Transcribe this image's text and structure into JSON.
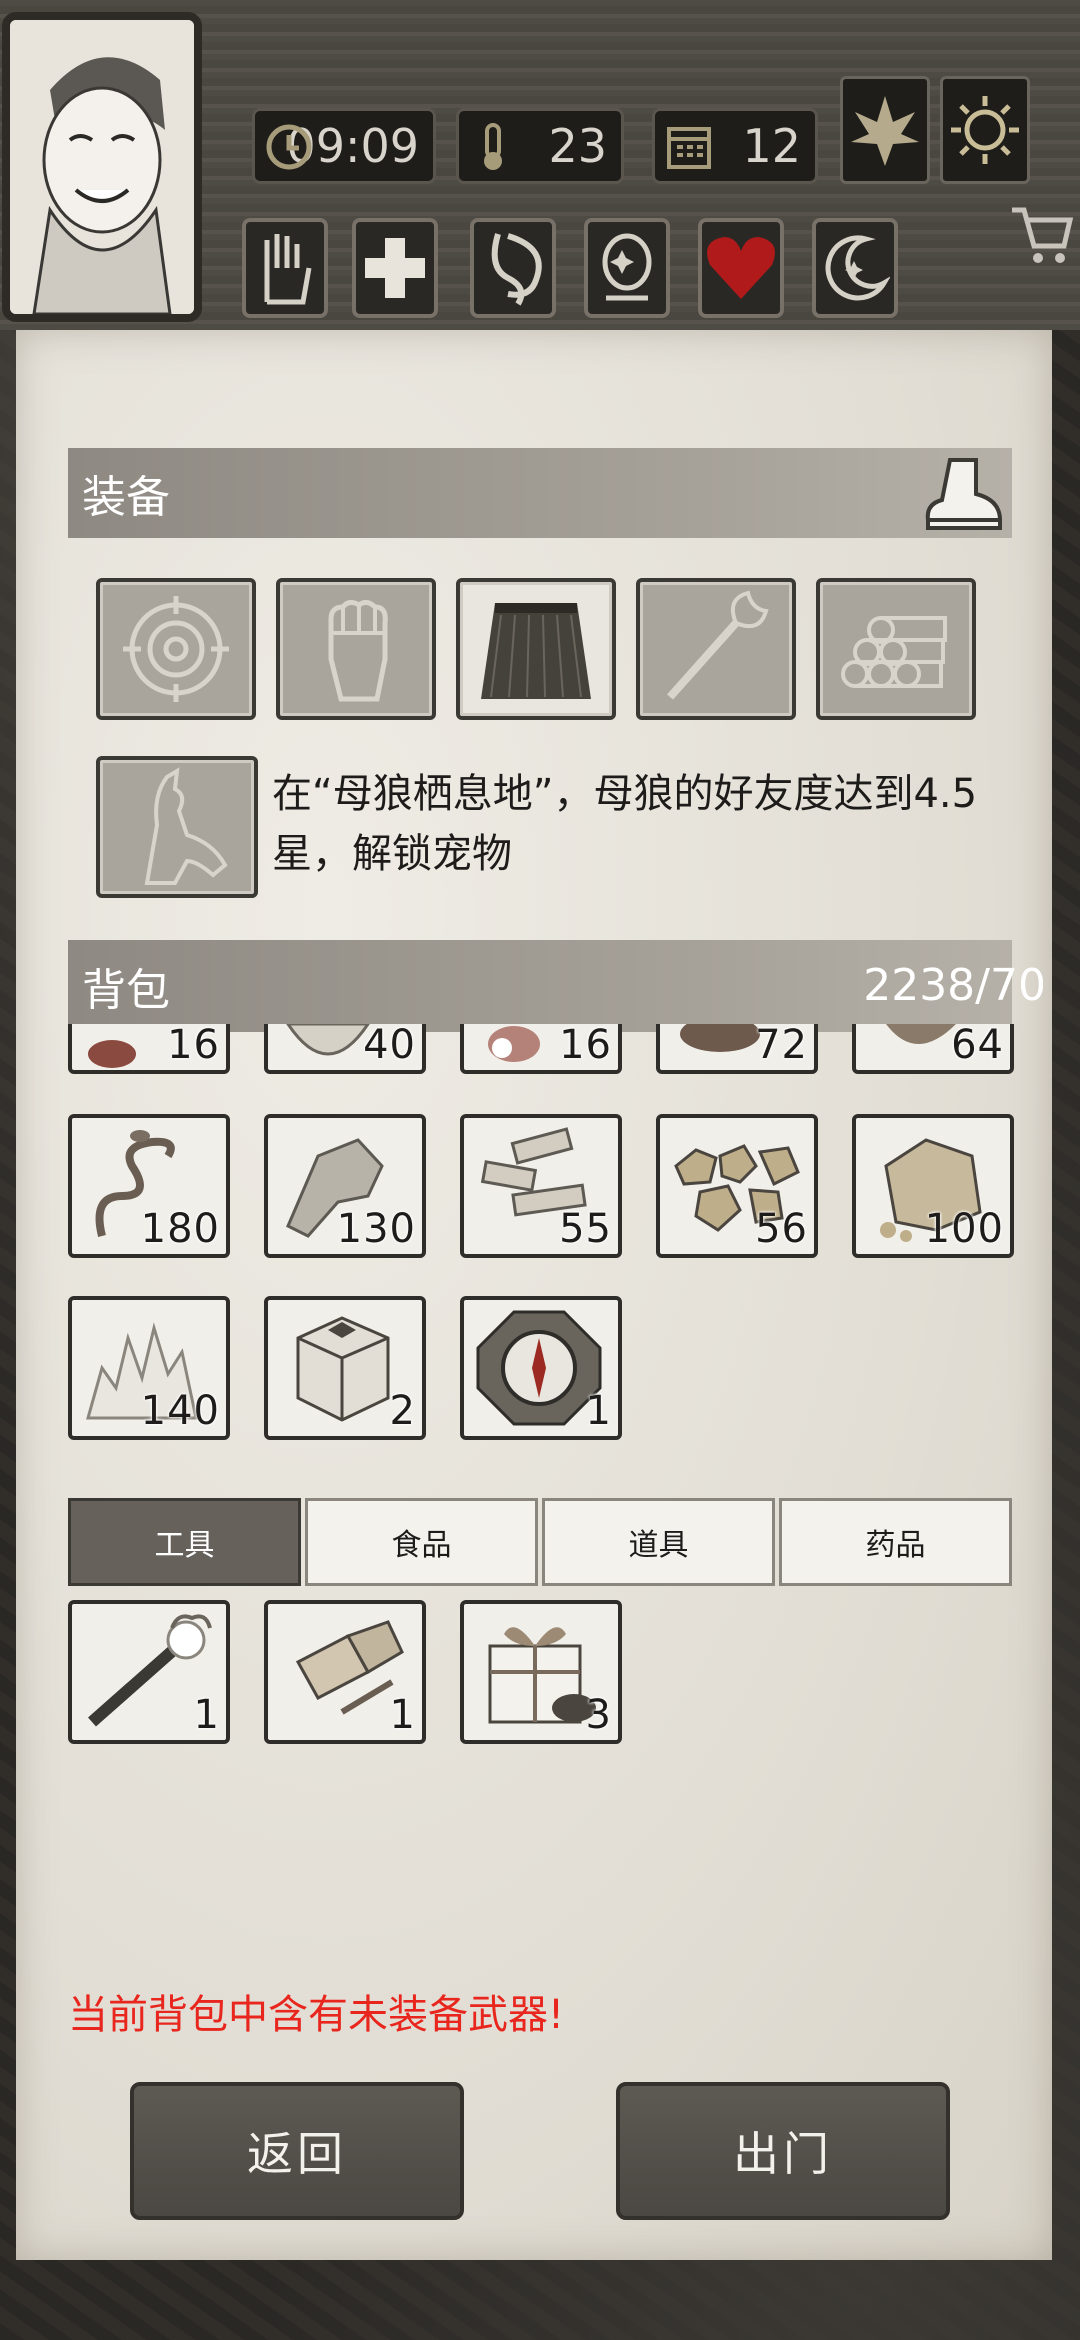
{
  "status": {
    "clock": "09:09",
    "temperature": "23",
    "day": "12"
  },
  "equipment": {
    "title": "装备",
    "pet_hint": "在“母狼栖息地”，母狼的好友度达到4.5星，解锁宠物"
  },
  "backpack": {
    "title": "背包",
    "capacity": "2238/70",
    "top_row_partial": [
      {
        "name": "meat-slices",
        "qty": "16"
      },
      {
        "name": "bowl",
        "qty": "40"
      },
      {
        "name": "raw-meat",
        "qty": "16"
      },
      {
        "name": "leather",
        "qty": "72"
      },
      {
        "name": "basket",
        "qty": "64"
      }
    ],
    "items": [
      {
        "name": "vine",
        "qty": "180"
      },
      {
        "name": "stone",
        "qty": "130"
      },
      {
        "name": "wood-planks",
        "qty": "55"
      },
      {
        "name": "gold-ore",
        "qty": "56"
      },
      {
        "name": "sandstone",
        "qty": "100"
      },
      {
        "name": "salt-crystal",
        "qty": "140"
      },
      {
        "name": "mystery-box",
        "qty": "2"
      },
      {
        "name": "compass",
        "qty": "1"
      }
    ]
  },
  "tabs": [
    "工具",
    "食品",
    "道具",
    "药品"
  ],
  "tool_items": [
    {
      "name": "torch",
      "qty": "1"
    },
    {
      "name": "flashlight",
      "qty": "1"
    },
    {
      "name": "gift-box",
      "qty": "3"
    }
  ],
  "warning": "当前背包中含有未装备武器!",
  "buttons": {
    "back": "返回",
    "go_out": "出门"
  },
  "colors": {
    "warning": "#e8261d",
    "heart": "#b11a1a",
    "active_tab": "#66625b"
  }
}
